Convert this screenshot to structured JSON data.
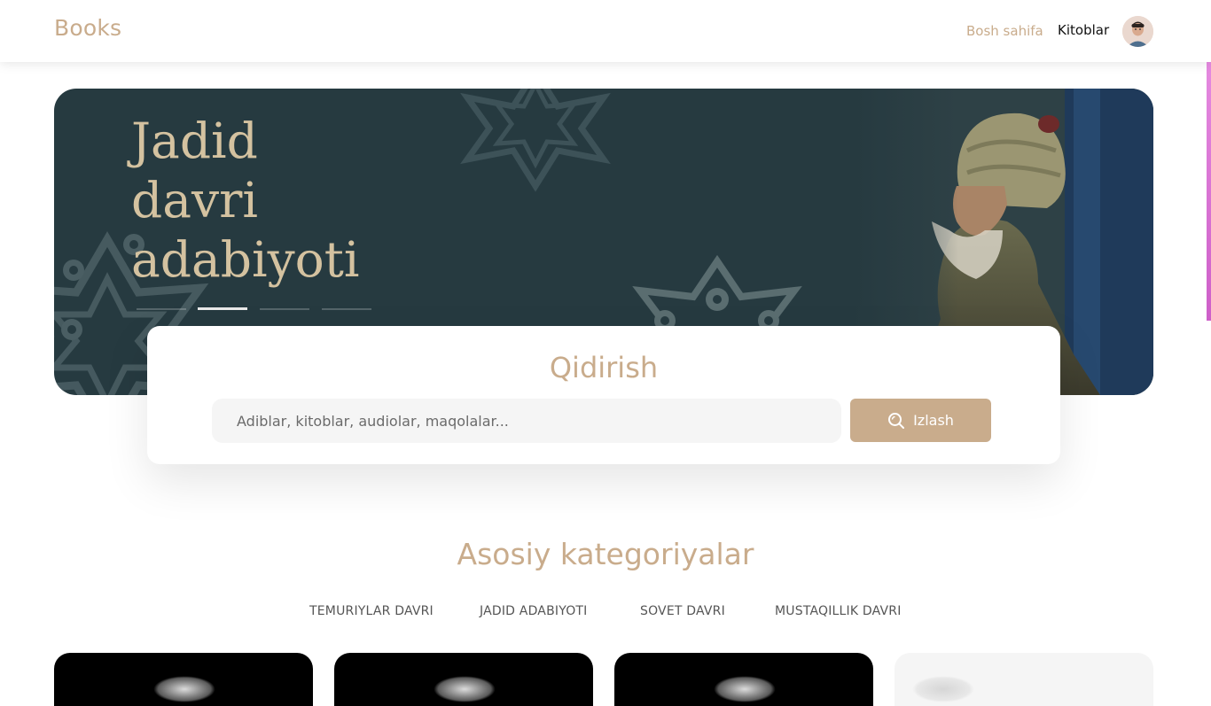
{
  "navbar": {
    "brand": "Books",
    "links": [
      {
        "label": "Bosh sahifa",
        "active": true
      },
      {
        "label": "Kitoblar",
        "active": false
      }
    ],
    "avatar_icon": "user-avatar"
  },
  "hero": {
    "title": "Jadid davri adabiyoti",
    "slides_count": 4,
    "active_slide": 2
  },
  "search": {
    "title": "Qidirish",
    "placeholder": "Adiblar, kitoblar, audiolar, maqolalar...",
    "button_label": "Izlash",
    "button_icon": "search-icon"
  },
  "categories": {
    "title": "Asosiy kategoriyalar",
    "tabs": [
      "TEMURIYLAR DAVRI",
      "JADID ADABIYOTI",
      "SOVET DAVRI",
      "MUSTAQILLIK DAVRI"
    ]
  },
  "colors": {
    "accent": "#c9ac8c",
    "hero_background": "#263a40",
    "hero_title": "#d4c2a0"
  }
}
